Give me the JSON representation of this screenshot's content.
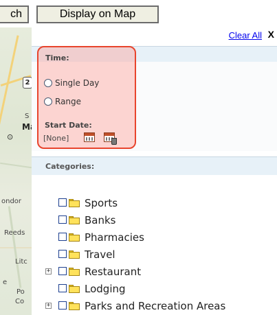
{
  "toolbar": {
    "search_button_label": "ch",
    "display_on_map_label": "Display on Map"
  },
  "map": {
    "labels": [
      "2",
      "S",
      "Ma",
      "ondor",
      "Reeds",
      "Litc",
      "e",
      "Po",
      "Co"
    ]
  },
  "panel": {
    "clear_all_label": "Clear All",
    "close_label": "X"
  },
  "time_section": {
    "title": "Time:",
    "options": [
      {
        "label": "Single Day",
        "selected": false
      },
      {
        "label": "Range",
        "selected": false
      }
    ],
    "start_date_label": "Start Date:",
    "start_date_value": "[None]",
    "icons": [
      "calendar-icon",
      "clear-date-icon"
    ],
    "highlight_color": "#e8442c"
  },
  "categories_section": {
    "title": "Categories:",
    "items": [
      {
        "label": "Sports",
        "expandable": false,
        "checked": false
      },
      {
        "label": "Banks",
        "expandable": false,
        "checked": false
      },
      {
        "label": "Pharmacies",
        "expandable": false,
        "checked": false
      },
      {
        "label": "Travel",
        "expandable": false,
        "checked": false
      },
      {
        "label": "Restaurant",
        "expandable": true,
        "checked": false
      },
      {
        "label": "Lodging",
        "expandable": false,
        "checked": false
      },
      {
        "label": "Parks and Recreation Areas",
        "expandable": true,
        "checked": false
      }
    ],
    "expander_symbol": "+"
  },
  "colors": {
    "section_header_bg": "#e7f1f8",
    "link": "#0000ee",
    "checkbox_border": "#1c3f8f",
    "folder": "#ffe25b"
  }
}
